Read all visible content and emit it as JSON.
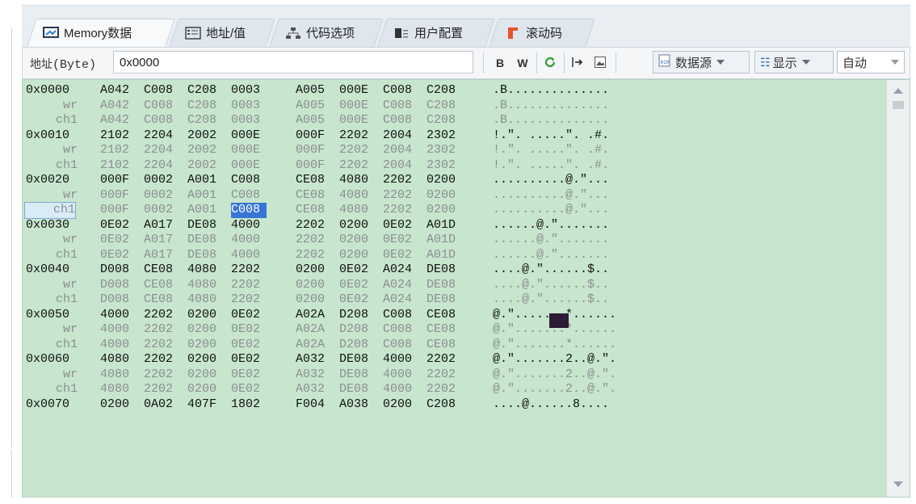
{
  "tabs": [
    {
      "label": "Memory数据",
      "icon": "monitor-icon",
      "active": true
    },
    {
      "label": "地址/值",
      "icon": "address-list-icon",
      "active": false
    },
    {
      "label": "代码选项",
      "icon": "code-options-icon",
      "active": false
    },
    {
      "label": "用户配置",
      "icon": "user-config-icon",
      "active": false
    },
    {
      "label": "滚动码",
      "icon": "rolling-code-icon",
      "active": false
    }
  ],
  "toolbar": {
    "address_label": "地址",
    "address_unit": "(Byte)",
    "address_value": "0x0000",
    "bold_label": "B",
    "word_label": "W",
    "data_source_label": "数据源",
    "display_label": "显示",
    "mode_value": "自动"
  },
  "colors": {
    "content_bg": "#c7e6cd",
    "highlight": "#3875d7",
    "cursor_block": "#2d1a36"
  },
  "memory": {
    "rows": [
      {
        "addr": "0x0000",
        "kind": "primary",
        "words": [
          "A042",
          "C008",
          "C208",
          "0003",
          "A005",
          "000E",
          "C008",
          "C208"
        ],
        "ascii": ".B.............."
      },
      {
        "addr": "wr",
        "kind": "sub",
        "words": [
          "A042",
          "C008",
          "C208",
          "0003",
          "A005",
          "000E",
          "C008",
          "C208"
        ],
        "ascii": ".B.............."
      },
      {
        "addr": "ch1",
        "kind": "sub",
        "words": [
          "A042",
          "C008",
          "C208",
          "0003",
          "A005",
          "000E",
          "C008",
          "C208"
        ],
        "ascii": ".B.............."
      },
      {
        "addr": "0x0010",
        "kind": "primary",
        "words": [
          "2102",
          "2204",
          "2002",
          "000E",
          "000F",
          "2202",
          "2004",
          "2302"
        ],
        "ascii": "!.″. .....″. .#."
      },
      {
        "addr": "wr",
        "kind": "sub",
        "words": [
          "2102",
          "2204",
          "2002",
          "000E",
          "000F",
          "2202",
          "2004",
          "2302"
        ],
        "ascii": "!.″. .....″. .#."
      },
      {
        "addr": "ch1",
        "kind": "sub",
        "words": [
          "2102",
          "2204",
          "2002",
          "000E",
          "000F",
          "2202",
          "2004",
          "2302"
        ],
        "ascii": "!.″. .....″. .#."
      },
      {
        "addr": "0x0020",
        "kind": "primary",
        "words": [
          "000F",
          "0002",
          "A001",
          "C008",
          "CE08",
          "4080",
          "2202",
          "0200"
        ],
        "ascii": "..........@.″..."
      },
      {
        "addr": "wr",
        "kind": "sub",
        "words": [
          "000F",
          "0002",
          "A001",
          "C008",
          "CE08",
          "4080",
          "2202",
          "0200"
        ],
        "ascii": "..........@.″..."
      },
      {
        "addr": "ch1",
        "kind": "sub",
        "selected": true,
        "words": [
          "000F",
          "0002",
          "A001",
          "C008",
          "CE08",
          "4080",
          "2202",
          "0200"
        ],
        "ascii": "..........@.″..."
      },
      {
        "addr": "0x0030",
        "kind": "primary",
        "words": [
          "0E02",
          "A017",
          "DE08",
          "4000",
          "2202",
          "0200",
          "0E02",
          "A01D"
        ],
        "ascii": "......@.″......."
      },
      {
        "addr": "wr",
        "kind": "sub",
        "words": [
          "0E02",
          "A017",
          "DE08",
          "4000",
          "2202",
          "0200",
          "0E02",
          "A01D"
        ],
        "ascii": "......@.″......."
      },
      {
        "addr": "ch1",
        "kind": "sub",
        "words": [
          "0E02",
          "A017",
          "DE08",
          "4000",
          "2202",
          "0200",
          "0E02",
          "A01D"
        ],
        "ascii": "......@.″......."
      },
      {
        "addr": "0x0040",
        "kind": "primary",
        "words": [
          "D008",
          "CE08",
          "4080",
          "2202",
          "0200",
          "0E02",
          "A024",
          "DE08"
        ],
        "ascii": "....@.″......$.."
      },
      {
        "addr": "wr",
        "kind": "sub",
        "words": [
          "D008",
          "CE08",
          "4080",
          "2202",
          "0200",
          "0E02",
          "A024",
          "DE08"
        ],
        "ascii": "....@.″......$.."
      },
      {
        "addr": "ch1",
        "kind": "sub",
        "words": [
          "D008",
          "CE08",
          "4080",
          "2202",
          "0200",
          "0E02",
          "A024",
          "DE08"
        ],
        "ascii": "....@.″......$.."
      },
      {
        "addr": "0x0050",
        "kind": "primary",
        "words": [
          "4000",
          "2202",
          "0200",
          "0E02",
          "A02A",
          "D208",
          "C008",
          "CE08"
        ],
        "ascii": "@.″.......*......"
      },
      {
        "addr": "wr",
        "kind": "sub",
        "words": [
          "4000",
          "2202",
          "0200",
          "0E02",
          "A02A",
          "D208",
          "C008",
          "CE08"
        ],
        "ascii": "@.″.......*......"
      },
      {
        "addr": "ch1",
        "kind": "sub",
        "words": [
          "4000",
          "2202",
          "0200",
          "0E02",
          "A02A",
          "D208",
          "C008",
          "CE08"
        ],
        "ascii": "@.″.......*......"
      },
      {
        "addr": "0x0060",
        "kind": "primary",
        "words": [
          "4080",
          "2202",
          "0200",
          "0E02",
          "A032",
          "DE08",
          "4000",
          "2202"
        ],
        "ascii": "@.″.......2..@.″."
      },
      {
        "addr": "wr",
        "kind": "sub",
        "words": [
          "4080",
          "2202",
          "0200",
          "0E02",
          "A032",
          "DE08",
          "4000",
          "2202"
        ],
        "ascii": "@.″.......2..@.″."
      },
      {
        "addr": "ch1",
        "kind": "sub",
        "words": [
          "4080",
          "2202",
          "0200",
          "0E02",
          "A032",
          "DE08",
          "4000",
          "2202"
        ],
        "ascii": "@.″.......2..@.″."
      },
      {
        "addr": "0x0070",
        "kind": "primary",
        "words": [
          "0200",
          "0A02",
          "407F",
          "1802",
          "F004",
          "A038",
          "0200",
          "C208"
        ],
        "ascii": "....@......8...."
      }
    ]
  }
}
